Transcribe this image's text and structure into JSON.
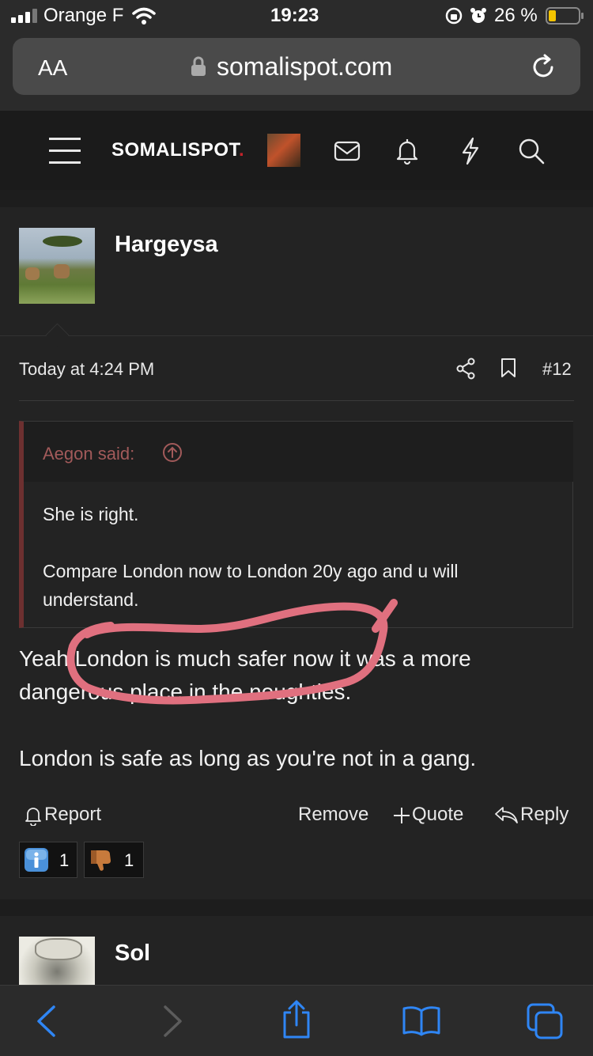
{
  "status": {
    "carrier": "Orange F",
    "time": "19:23",
    "battery_percent": "26 %",
    "battery_level": 0.26
  },
  "browser": {
    "text_size_label": "AA",
    "domain": "somalispot.com"
  },
  "site": {
    "logo_text": "SOMALISPOT",
    "logo_dot": ".",
    "accent": "#c2232a"
  },
  "post": {
    "username": "Hargeysa",
    "timestamp": "Today at 4:24 PM",
    "post_number": "#12",
    "quote": {
      "author_label": "Aegon said:",
      "line1": "She is right.",
      "line2": "Compare London now to London 20y ago and u will",
      "line3": "understand."
    },
    "body": {
      "line1": "Yeah London is much safer now it was a more",
      "line2": "dangerous place in the noughties.",
      "line3": "London is safe as long as you're not in a gang."
    },
    "actions": {
      "report": "Report",
      "remove": "Remove",
      "quote": "Quote",
      "reply": "Reply"
    },
    "reactions": [
      {
        "icon": "info-icon",
        "count": "1"
      },
      {
        "icon": "thumbs-down-icon",
        "count": "1"
      }
    ]
  },
  "next_post": {
    "username": "Sol"
  }
}
